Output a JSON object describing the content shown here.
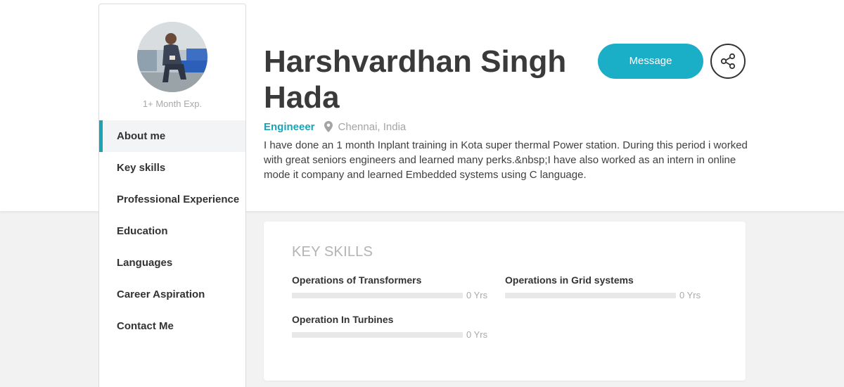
{
  "profile": {
    "name": "Harshvardhan Singh Hada",
    "experience": "1+ Month Exp.",
    "role": "Engineeer",
    "location": "Chennai, India",
    "about": "I have done an 1 month Inplant training in Kota super thermal Power station. During this period i worked with great seniors engineers and learned many perks.&nbsp;I have also worked as an intern in online mode it company and learned Embedded systems using C language."
  },
  "sidebar": {
    "items": [
      {
        "label": "About me",
        "active": true
      },
      {
        "label": "Key skills"
      },
      {
        "label": "Professional Experience"
      },
      {
        "label": "Education"
      },
      {
        "label": "Languages"
      },
      {
        "label": "Career Aspiration"
      },
      {
        "label": "Contact Me"
      }
    ]
  },
  "actions": {
    "message_label": "Message",
    "share_icon": "share-icon"
  },
  "skills": {
    "title": "KEY SKILLS",
    "items": [
      {
        "name": "Operations of Transformers",
        "years": "0 Yrs",
        "level": 0
      },
      {
        "name": "Operations in Grid systems",
        "years": "0 Yrs",
        "level": 0
      },
      {
        "name": "Operation In Turbines",
        "years": "0 Yrs",
        "level": 0
      }
    ]
  },
  "colors": {
    "accent": "#1aa3b5",
    "button": "#1bafc7"
  }
}
